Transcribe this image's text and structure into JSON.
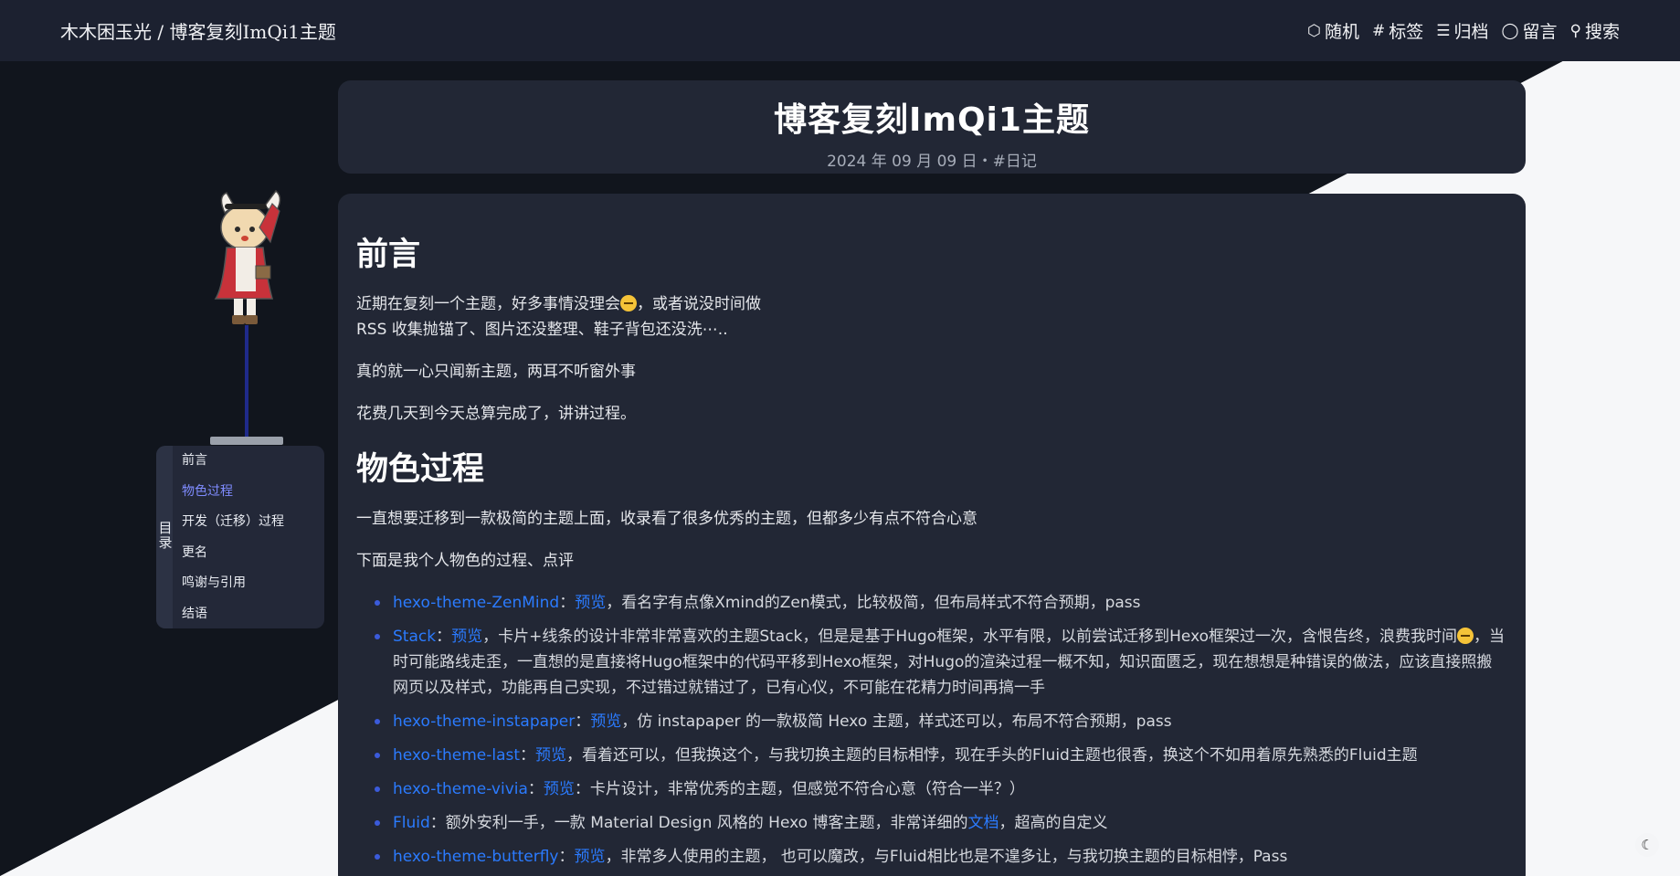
{
  "nav": {
    "brand": "木木困玉光 / 博客复刻ImQi1主题",
    "links": [
      {
        "icon": "cube-icon",
        "glyph": "⬡",
        "label": "随机"
      },
      {
        "icon": "hash-icon",
        "glyph": "#",
        "label": "标签"
      },
      {
        "icon": "list-icon",
        "glyph": "☰",
        "label": "归档"
      },
      {
        "icon": "comment-icon",
        "glyph": "◯",
        "label": "留言"
      },
      {
        "icon": "search-icon",
        "glyph": "⚲",
        "label": "搜索"
      }
    ]
  },
  "post": {
    "title": "博客复刻ImQi1主题",
    "meta": "2024 年 09 月 09 日・#日记"
  },
  "content": {
    "h_intro": "前言",
    "p1_a": "近期在复刻一个主题，好多事情没理会",
    "p1_b": "，或者说没时间做",
    "p1_c": "RSS 收集抛锚了、图片还没整理、鞋子背包还没洗⋯..",
    "p2": "真的就一心只闻新主题，两耳不听窗外事",
    "p3": "花费几天到今天总算完成了，讲讲过程。",
    "h_process": "物色过程",
    "p4": "一直想要迁移到一款极简的主题上面，收录看了很多优秀的主题，但都多少有点不符合心意",
    "p5": "下面是我个人物色的过程、点评",
    "preview": "预览",
    "items": [
      {
        "name": "hexo-theme-ZenMind",
        "text": "，看名字有点像Xmind的Zen模式，比较极简，但布局样式不符合预期，pass"
      },
      {
        "name": "Stack",
        "text": "，卡片+线条的设计非常非常喜欢的主题Stack，但是是基于Hugo框架，水平有限，以前尝试迁移到Hexo框架过一次，含恨告终，浪费我时间",
        "text2": "，当时可能路线走歪，一直想的是直接将Hugo框架中的代码平移到Hexo框架，对Hugo的渲染过程一概不知，知识面匮乏，现在想想是种错误的做法，应该直接照搬网页以及样式，功能再自己实现，不过错过就错过了，已有心仪，不可能在花精力时间再搞一手"
      },
      {
        "name": "hexo-theme-instapaper",
        "text": "，仿 instapaper 的一款极简 Hexo 主题，样式还可以，布局不符合预期，pass"
      },
      {
        "name": "hexo-theme-last",
        "text": "，看着还可以，但我换这个，与我切换主题的目标相悖，现在手头的Fluid主题也很香，换这个不如用着原先熟悉的Fluid主题"
      },
      {
        "name": "hexo-theme-vivia",
        "text": "：卡片设计，非常优秀的主题，但感觉不符合心意（符合一半？）"
      },
      {
        "name": "Fluid",
        "text_a": "：额外安利一手，一款 Material Design 风格的 Hexo 博客主题，非常详细的",
        "doc": "文档",
        "text_b": "，超高的自定义"
      },
      {
        "name": "hexo-theme-butterfly",
        "text": "，非常多人使用的主题， 也可以魔改，与Fluid相比也是不遑多让，与我切换主题的目标相悖，Pass"
      }
    ]
  },
  "toc": {
    "title": "目录",
    "items": [
      "前言",
      "物色过程",
      "开发（迁移）过程",
      "更名",
      "鸣谢与引用",
      "结语"
    ],
    "active_index": 1
  },
  "colors": {
    "link": "#2b7bff",
    "toc_active": "#7f8cff",
    "dark_bg": "#11151d",
    "light_bg": "#f6f7f9",
    "card": "#222735"
  },
  "theme_toggle_icon": "moon-icon"
}
